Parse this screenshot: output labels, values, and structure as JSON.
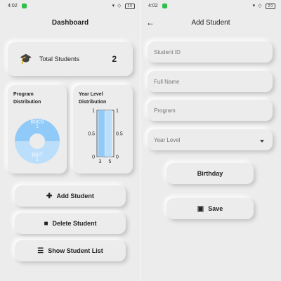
{
  "status_bar": {
    "time": "4:02",
    "signal_icons": "▾ ◇",
    "battery": "20"
  },
  "dashboard": {
    "title": "Dashboard",
    "total_students": {
      "icon": "graduation-cap-icon",
      "label": "Total Students",
      "value": "2"
    },
    "program_card": {
      "title_line1": "Program",
      "title_line2": "Distribution"
    },
    "year_card": {
      "title_line1": "Year Level",
      "title_line2": "Distribution"
    },
    "buttons": {
      "add": {
        "icon": "add-person-icon",
        "label": "Add Student"
      },
      "delete": {
        "icon": "trash-icon",
        "label": "Delete Student"
      },
      "list": {
        "icon": "list-icon",
        "label": "Show Student List"
      }
    }
  },
  "add_student": {
    "title": "Add Student",
    "fields": {
      "student_id": "Student ID",
      "full_name": "Full Name",
      "program": "Program",
      "year_level": "Year Level"
    },
    "buttons": {
      "birthday": {
        "label": "Birthday"
      },
      "save": {
        "icon": "save-icon",
        "label": "Save"
      }
    }
  },
  "chart_data": [
    {
      "type": "pie",
      "title": "Program Distribution",
      "categories": [
        "BSCS",
        "BSIT"
      ],
      "values": [
        1,
        1
      ],
      "colors": [
        "#90caf9",
        "#bbdefb"
      ]
    },
    {
      "type": "bar",
      "title": "Year Level Distribution",
      "categories": [
        "3",
        "5"
      ],
      "values": [
        1,
        1
      ],
      "ylim": [
        0,
        1
      ],
      "yticks": [
        "1",
        "0.5",
        "0"
      ],
      "colors": [
        "#90caf9",
        "#bbdefb"
      ]
    }
  ],
  "colors": {
    "background": "#ececec",
    "accent": "#90caf9",
    "accent_light": "#bbdefb"
  }
}
